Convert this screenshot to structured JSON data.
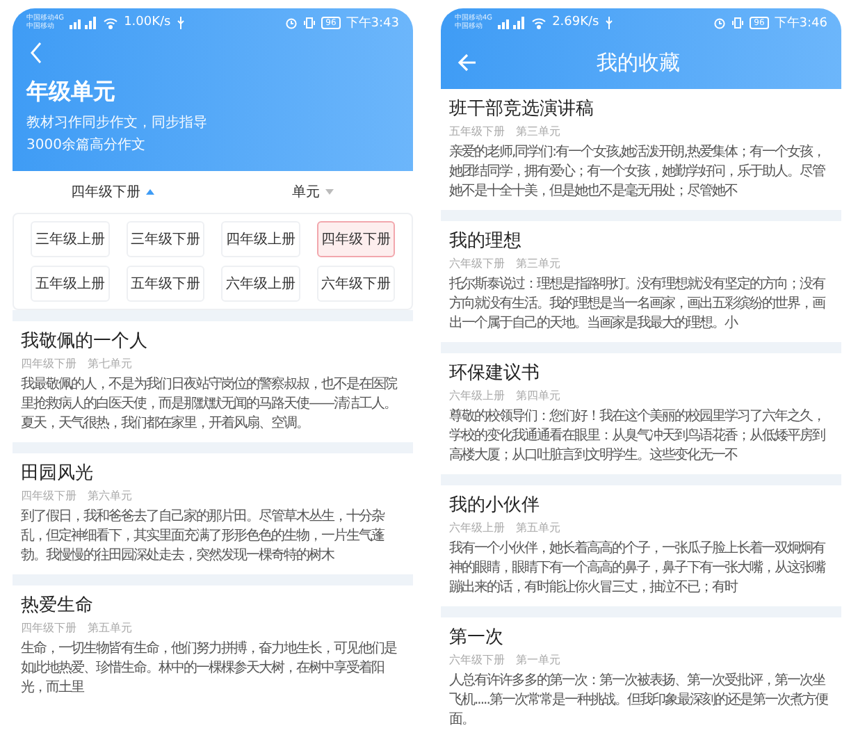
{
  "screens": [
    {
      "kind": "grade",
      "status_bar": {
        "carrier_top": "中国移动4G",
        "carrier_bottom": "中国移动",
        "speed": "1.00K/s",
        "battery": "96",
        "time": "下午3:43"
      },
      "header": {
        "title": "年级单元",
        "lines": [
          "教材习作同步作文，同步指导",
          "3000余篇高分作文"
        ]
      },
      "filters": [
        {
          "label": "四年级下册",
          "expanded": true
        },
        {
          "label": "单元",
          "expanded": false
        }
      ],
      "grades": [
        {
          "label": "三年级上册",
          "selected": false
        },
        {
          "label": "三年级下册",
          "selected": false
        },
        {
          "label": "四年级上册",
          "selected": false
        },
        {
          "label": "四年级下册",
          "selected": true
        },
        {
          "label": "五年级上册",
          "selected": false
        },
        {
          "label": "五年级下册",
          "selected": false
        },
        {
          "label": "六年级上册",
          "selected": false
        },
        {
          "label": "六年级下册",
          "selected": false
        }
      ],
      "articles": [
        {
          "title": "我敬佩的一个人",
          "book": "四年级下册",
          "unit": "第七单元",
          "excerpt": "我最敬佩的人，不是为我们日夜站守岗位的警察叔叔，也不是在医院里抢救病人的白医天使，而是那默默无闻的马路天使——清洁工人。夏天，天气很热，我们都在家里，开着风扇、空调。"
        },
        {
          "title": "田园风光",
          "book": "四年级下册",
          "unit": "第六单元",
          "excerpt": "到了假日，我和爸爸去了自己家的那片田。尽管草木丛生，十分杂乱，但定神细看下，其实里面充满了形形色色的生物，一片生气蓬勃。我慢慢的往田园深处走去，突然发现一棵奇特的树木"
        },
        {
          "title": "热爱生命",
          "book": "四年级下册",
          "unit": "第五单元",
          "excerpt": "生命，一切生物皆有生命，他们努力拼搏，奋力地生长，可见他们是如此地热爱、珍惜生命。林中的一棵棵参天大树，在树中享受着阳光，而土里"
        }
      ]
    },
    {
      "kind": "favorites",
      "status_bar": {
        "carrier_top": "中国移动4G",
        "carrier_bottom": "中国移动",
        "speed": "2.69K/s",
        "battery": "96",
        "time": "下午3:46"
      },
      "header": {
        "title": "我的收藏"
      },
      "articles": [
        {
          "title": "班干部竞选演讲稿",
          "book": "五年级下册",
          "unit": "第三单元",
          "excerpt": "亲爱的老师,同学们:有一个女孩,她活泼开朗,热爱集体；有一个女孩，她团结同学，拥有爱心；有一个女孩，她勤学好问，乐于助人。尽管她不是十全十美，但是她也不是毫无用处；尽管她不"
        },
        {
          "title": "我的理想",
          "book": "六年级下册",
          "unit": "第三单元",
          "excerpt": "托尔斯泰说过：理想是指路明灯。没有理想就没有坚定的方向；没有方向就没有生活。我的理想是当一名画家，画出五彩缤纷的世界，画出一个属于自己的天地。当画家是我最大的理想。小"
        },
        {
          "title": "环保建议书",
          "book": "六年级上册",
          "unit": "第四单元",
          "excerpt": "尊敬的校领导们：您们好！我在这个美丽的校园里学习了六年之久，学校的变化我通通看在眼里：从臭气冲天到鸟语花香；从低矮平房到高楼大厦；从口吐脏言到文明学生。这些变化无一不"
        },
        {
          "title": "我的小伙伴",
          "book": "六年级上册",
          "unit": "第五单元",
          "excerpt": "我有一个小伙伴，她长着高高的个子，一张瓜子脸上长着一双炯炯有神的眼睛，眼睛下有一个高高的鼻子，鼻子下有一张大嘴，从这张嘴蹦出来的话，有时能让你火冒三丈，抽泣不已；有时"
        },
        {
          "title": "第一次",
          "book": "六年级下册",
          "unit": "第一单元",
          "excerpt": "人总有许许多多的第一次：第一次被表扬、第一次受批评，第一次坐飞机.....第一次常常是一种挑战。但我印象最深刻的还是第一次煮方便面。"
        }
      ]
    }
  ]
}
